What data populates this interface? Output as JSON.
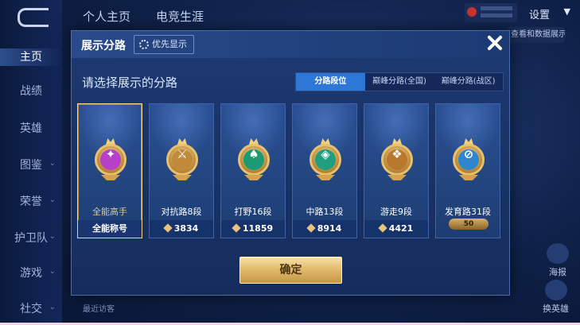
{
  "background": {
    "top_tabs": [
      "个人主页",
      "电竞生涯"
    ],
    "settings_label": "设置",
    "peek_button_label": "查看和数据展示",
    "sidebar_items": [
      "主页",
      "战绩",
      "英雄",
      "图鉴",
      "荣誉",
      "护卫队",
      "游戏",
      "社交"
    ],
    "recent_label": "最近访客",
    "right_actions": [
      {
        "label": "海报",
        "icon": "poster-icon"
      },
      {
        "label": "换英雄",
        "icon": "swap-hero-icon"
      }
    ]
  },
  "dialog": {
    "title": "展示分路",
    "priority_button": "优先显示",
    "subtitle": "请选择展示的分路",
    "tabs": [
      {
        "label": "分路段位",
        "active": true
      },
      {
        "label": "巅峰分路(全国)",
        "active": false
      },
      {
        "label": "巅峰分路(战区)",
        "active": false
      }
    ],
    "cards": [
      {
        "name": "全能高手",
        "footer": "全能称号",
        "selected": true,
        "medal_color": "#b640c8",
        "icon": "all-round-medal-icon"
      },
      {
        "name": "对抗路8段",
        "score": "3834",
        "selected": false,
        "medal_color": "#c08a3a",
        "icon": "clash-lane-medal-icon"
      },
      {
        "name": "打野16段",
        "score": "11859",
        "selected": false,
        "medal_color": "#1c9a73",
        "icon": "jungle-medal-icon"
      },
      {
        "name": "中路13段",
        "score": "8914",
        "selected": false,
        "medal_color": "#1f9f7f",
        "icon": "mid-lane-medal-icon"
      },
      {
        "name": "游走9段",
        "score": "4421",
        "selected": false,
        "medal_color": "#b8792e",
        "icon": "roam-medal-icon"
      },
      {
        "name": "发育路31段",
        "badge": "50",
        "selected": false,
        "medal_color": "#2e86cf",
        "icon": "farm-lane-medal-icon"
      }
    ],
    "confirm_label": "确定"
  }
}
